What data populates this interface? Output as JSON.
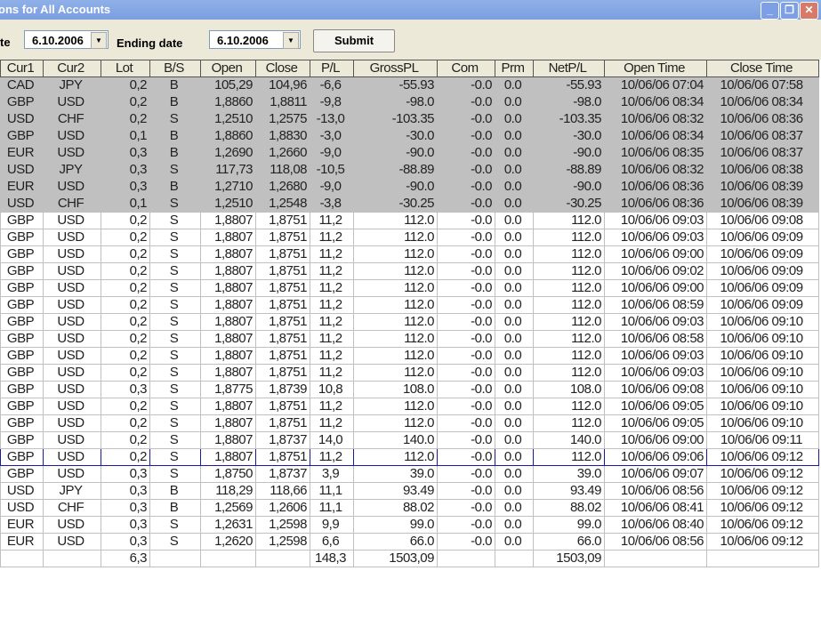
{
  "window": {
    "title": "ons for All Accounts",
    "minimize": "_",
    "restore": "❐",
    "close": "✕"
  },
  "toolbar": {
    "start_label": "te",
    "start_date": "6.10.2006",
    "end_label": "Ending date",
    "end_date": "6.10.2006",
    "submit": "Submit"
  },
  "columns": [
    "Cur1",
    "Cur2",
    "Lot",
    "B/S",
    "Open",
    "Close",
    "P/L",
    "GrossPL",
    "Com",
    "Prm",
    "NetP/L",
    "Open Time",
    "Close Time"
  ],
  "rows": [
    [
      "CAD",
      "JPY",
      "0,2",
      "B",
      "105,29",
      "104,96",
      "-6,6",
      "-55.93",
      "-0.0",
      "0.0",
      "-55.93",
      "10/06/06 07:04",
      "10/06/06 07:58"
    ],
    [
      "GBP",
      "USD",
      "0,2",
      "B",
      "1,8860",
      "1,8811",
      "-9,8",
      "-98.0",
      "-0.0",
      "0.0",
      "-98.0",
      "10/06/06 08:34",
      "10/06/06 08:34"
    ],
    [
      "USD",
      "CHF",
      "0,2",
      "S",
      "1,2510",
      "1,2575",
      "-13,0",
      "-103.35",
      "-0.0",
      "0.0",
      "-103.35",
      "10/06/06 08:32",
      "10/06/06 08:36"
    ],
    [
      "GBP",
      "USD",
      "0,1",
      "B",
      "1,8860",
      "1,8830",
      "-3,0",
      "-30.0",
      "-0.0",
      "0.0",
      "-30.0",
      "10/06/06 08:34",
      "10/06/06 08:37"
    ],
    [
      "EUR",
      "USD",
      "0,3",
      "B",
      "1,2690",
      "1,2660",
      "-9,0",
      "-90.0",
      "-0.0",
      "0.0",
      "-90.0",
      "10/06/06 08:35",
      "10/06/06 08:37"
    ],
    [
      "USD",
      "JPY",
      "0,3",
      "S",
      "117,73",
      "118,08",
      "-10,5",
      "-88.89",
      "-0.0",
      "0.0",
      "-88.89",
      "10/06/06 08:32",
      "10/06/06 08:38"
    ],
    [
      "EUR",
      "USD",
      "0,3",
      "B",
      "1,2710",
      "1,2680",
      "-9,0",
      "-90.0",
      "-0.0",
      "0.0",
      "-90.0",
      "10/06/06 08:36",
      "10/06/06 08:39"
    ],
    [
      "USD",
      "CHF",
      "0,1",
      "S",
      "1,2510",
      "1,2548",
      "-3,8",
      "-30.25",
      "-0.0",
      "0.0",
      "-30.25",
      "10/06/06 08:36",
      "10/06/06 08:39"
    ],
    [
      "GBP",
      "USD",
      "0,2",
      "S",
      "1,8807",
      "1,8751",
      "11,2",
      "112.0",
      "-0.0",
      "0.0",
      "112.0",
      "10/06/06 09:03",
      "10/06/06 09:08"
    ],
    [
      "GBP",
      "USD",
      "0,2",
      "S",
      "1,8807",
      "1,8751",
      "11,2",
      "112.0",
      "-0.0",
      "0.0",
      "112.0",
      "10/06/06 09:03",
      "10/06/06 09:09"
    ],
    [
      "GBP",
      "USD",
      "0,2",
      "S",
      "1,8807",
      "1,8751",
      "11,2",
      "112.0",
      "-0.0",
      "0.0",
      "112.0",
      "10/06/06 09:00",
      "10/06/06 09:09"
    ],
    [
      "GBP",
      "USD",
      "0,2",
      "S",
      "1,8807",
      "1,8751",
      "11,2",
      "112.0",
      "-0.0",
      "0.0",
      "112.0",
      "10/06/06 09:02",
      "10/06/06 09:09"
    ],
    [
      "GBP",
      "USD",
      "0,2",
      "S",
      "1,8807",
      "1,8751",
      "11,2",
      "112.0",
      "-0.0",
      "0.0",
      "112.0",
      "10/06/06 09:00",
      "10/06/06 09:09"
    ],
    [
      "GBP",
      "USD",
      "0,2",
      "S",
      "1,8807",
      "1,8751",
      "11,2",
      "112.0",
      "-0.0",
      "0.0",
      "112.0",
      "10/06/06 08:59",
      "10/06/06 09:09"
    ],
    [
      "GBP",
      "USD",
      "0,2",
      "S",
      "1,8807",
      "1,8751",
      "11,2",
      "112.0",
      "-0.0",
      "0.0",
      "112.0",
      "10/06/06 09:03",
      "10/06/06 09:10"
    ],
    [
      "GBP",
      "USD",
      "0,2",
      "S",
      "1,8807",
      "1,8751",
      "11,2",
      "112.0",
      "-0.0",
      "0.0",
      "112.0",
      "10/06/06 08:58",
      "10/06/06 09:10"
    ],
    [
      "GBP",
      "USD",
      "0,2",
      "S",
      "1,8807",
      "1,8751",
      "11,2",
      "112.0",
      "-0.0",
      "0.0",
      "112.0",
      "10/06/06 09:03",
      "10/06/06 09:10"
    ],
    [
      "GBP",
      "USD",
      "0,2",
      "S",
      "1,8807",
      "1,8751",
      "11,2",
      "112.0",
      "-0.0",
      "0.0",
      "112.0",
      "10/06/06 09:03",
      "10/06/06 09:10"
    ],
    [
      "GBP",
      "USD",
      "0,3",
      "S",
      "1,8775",
      "1,8739",
      "10,8",
      "108.0",
      "-0.0",
      "0.0",
      "108.0",
      "10/06/06 09:08",
      "10/06/06 09:10"
    ],
    [
      "GBP",
      "USD",
      "0,2",
      "S",
      "1,8807",
      "1,8751",
      "11,2",
      "112.0",
      "-0.0",
      "0.0",
      "112.0",
      "10/06/06 09:05",
      "10/06/06 09:10"
    ],
    [
      "GBP",
      "USD",
      "0,2",
      "S",
      "1,8807",
      "1,8751",
      "11,2",
      "112.0",
      "-0.0",
      "0.0",
      "112.0",
      "10/06/06 09:05",
      "10/06/06 09:10"
    ],
    [
      "GBP",
      "USD",
      "0,2",
      "S",
      "1,8807",
      "1,8737",
      "14,0",
      "140.0",
      "-0.0",
      "0.0",
      "140.0",
      "10/06/06 09:00",
      "10/06/06 09:11"
    ],
    [
      "GBP",
      "USD",
      "0,2",
      "S",
      "1,8807",
      "1,8751",
      "11,2",
      "112.0",
      "-0.0",
      "0.0",
      "112.0",
      "10/06/06 09:06",
      "10/06/06 09:12"
    ],
    [
      "GBP",
      "USD",
      "0,3",
      "S",
      "1,8750",
      "1,8737",
      "3,9",
      "39.0",
      "-0.0",
      "0.0",
      "39.0",
      "10/06/06 09:07",
      "10/06/06 09:12"
    ],
    [
      "USD",
      "JPY",
      "0,3",
      "B",
      "118,29",
      "118,66",
      "11,1",
      "93.49",
      "-0.0",
      "0.0",
      "93.49",
      "10/06/06 08:56",
      "10/06/06 09:12"
    ],
    [
      "USD",
      "CHF",
      "0,3",
      "B",
      "1,2569",
      "1,2606",
      "11,1",
      "88.02",
      "-0.0",
      "0.0",
      "88.02",
      "10/06/06 08:41",
      "10/06/06 09:12"
    ],
    [
      "EUR",
      "USD",
      "0,3",
      "S",
      "1,2631",
      "1,2598",
      "9,9",
      "99.0",
      "-0.0",
      "0.0",
      "99.0",
      "10/06/06 08:40",
      "10/06/06 09:12"
    ],
    [
      "EUR",
      "USD",
      "0,3",
      "S",
      "1,2620",
      "1,2598",
      "6,6",
      "66.0",
      "-0.0",
      "0.0",
      "66.0",
      "10/06/06 08:56",
      "10/06/06 09:12"
    ]
  ],
  "closed_row_count": 8,
  "selected_row": 22,
  "totals": [
    "",
    "",
    "6,3",
    "",
    "",
    "",
    "148,3",
    "1503,09",
    "",
    "",
    "1503,09",
    "",
    ""
  ]
}
